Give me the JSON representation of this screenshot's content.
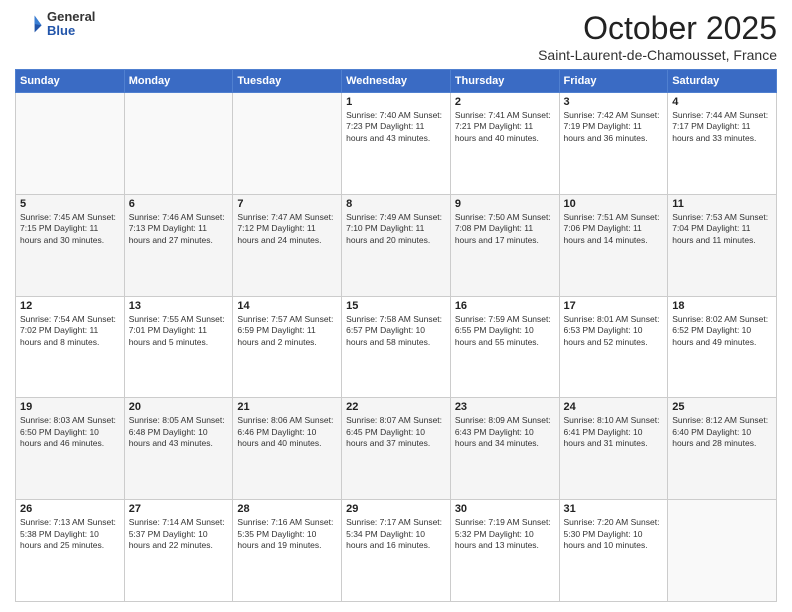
{
  "header": {
    "logo": {
      "general": "General",
      "blue": "Blue"
    },
    "title": "October 2025",
    "subtitle": "Saint-Laurent-de-Chamousset, France"
  },
  "weekdays": [
    "Sunday",
    "Monday",
    "Tuesday",
    "Wednesday",
    "Thursday",
    "Friday",
    "Saturday"
  ],
  "weeks": [
    [
      {
        "day": "",
        "info": ""
      },
      {
        "day": "",
        "info": ""
      },
      {
        "day": "",
        "info": ""
      },
      {
        "day": "1",
        "info": "Sunrise: 7:40 AM\nSunset: 7:23 PM\nDaylight: 11 hours\nand 43 minutes."
      },
      {
        "day": "2",
        "info": "Sunrise: 7:41 AM\nSunset: 7:21 PM\nDaylight: 11 hours\nand 40 minutes."
      },
      {
        "day": "3",
        "info": "Sunrise: 7:42 AM\nSunset: 7:19 PM\nDaylight: 11 hours\nand 36 minutes."
      },
      {
        "day": "4",
        "info": "Sunrise: 7:44 AM\nSunset: 7:17 PM\nDaylight: 11 hours\nand 33 minutes."
      }
    ],
    [
      {
        "day": "5",
        "info": "Sunrise: 7:45 AM\nSunset: 7:15 PM\nDaylight: 11 hours\nand 30 minutes."
      },
      {
        "day": "6",
        "info": "Sunrise: 7:46 AM\nSunset: 7:13 PM\nDaylight: 11 hours\nand 27 minutes."
      },
      {
        "day": "7",
        "info": "Sunrise: 7:47 AM\nSunset: 7:12 PM\nDaylight: 11 hours\nand 24 minutes."
      },
      {
        "day": "8",
        "info": "Sunrise: 7:49 AM\nSunset: 7:10 PM\nDaylight: 11 hours\nand 20 minutes."
      },
      {
        "day": "9",
        "info": "Sunrise: 7:50 AM\nSunset: 7:08 PM\nDaylight: 11 hours\nand 17 minutes."
      },
      {
        "day": "10",
        "info": "Sunrise: 7:51 AM\nSunset: 7:06 PM\nDaylight: 11 hours\nand 14 minutes."
      },
      {
        "day": "11",
        "info": "Sunrise: 7:53 AM\nSunset: 7:04 PM\nDaylight: 11 hours\nand 11 minutes."
      }
    ],
    [
      {
        "day": "12",
        "info": "Sunrise: 7:54 AM\nSunset: 7:02 PM\nDaylight: 11 hours\nand 8 minutes."
      },
      {
        "day": "13",
        "info": "Sunrise: 7:55 AM\nSunset: 7:01 PM\nDaylight: 11 hours\nand 5 minutes."
      },
      {
        "day": "14",
        "info": "Sunrise: 7:57 AM\nSunset: 6:59 PM\nDaylight: 11 hours\nand 2 minutes."
      },
      {
        "day": "15",
        "info": "Sunrise: 7:58 AM\nSunset: 6:57 PM\nDaylight: 10 hours\nand 58 minutes."
      },
      {
        "day": "16",
        "info": "Sunrise: 7:59 AM\nSunset: 6:55 PM\nDaylight: 10 hours\nand 55 minutes."
      },
      {
        "day": "17",
        "info": "Sunrise: 8:01 AM\nSunset: 6:53 PM\nDaylight: 10 hours\nand 52 minutes."
      },
      {
        "day": "18",
        "info": "Sunrise: 8:02 AM\nSunset: 6:52 PM\nDaylight: 10 hours\nand 49 minutes."
      }
    ],
    [
      {
        "day": "19",
        "info": "Sunrise: 8:03 AM\nSunset: 6:50 PM\nDaylight: 10 hours\nand 46 minutes."
      },
      {
        "day": "20",
        "info": "Sunrise: 8:05 AM\nSunset: 6:48 PM\nDaylight: 10 hours\nand 43 minutes."
      },
      {
        "day": "21",
        "info": "Sunrise: 8:06 AM\nSunset: 6:46 PM\nDaylight: 10 hours\nand 40 minutes."
      },
      {
        "day": "22",
        "info": "Sunrise: 8:07 AM\nSunset: 6:45 PM\nDaylight: 10 hours\nand 37 minutes."
      },
      {
        "day": "23",
        "info": "Sunrise: 8:09 AM\nSunset: 6:43 PM\nDaylight: 10 hours\nand 34 minutes."
      },
      {
        "day": "24",
        "info": "Sunrise: 8:10 AM\nSunset: 6:41 PM\nDaylight: 10 hours\nand 31 minutes."
      },
      {
        "day": "25",
        "info": "Sunrise: 8:12 AM\nSunset: 6:40 PM\nDaylight: 10 hours\nand 28 minutes."
      }
    ],
    [
      {
        "day": "26",
        "info": "Sunrise: 7:13 AM\nSunset: 5:38 PM\nDaylight: 10 hours\nand 25 minutes."
      },
      {
        "day": "27",
        "info": "Sunrise: 7:14 AM\nSunset: 5:37 PM\nDaylight: 10 hours\nand 22 minutes."
      },
      {
        "day": "28",
        "info": "Sunrise: 7:16 AM\nSunset: 5:35 PM\nDaylight: 10 hours\nand 19 minutes."
      },
      {
        "day": "29",
        "info": "Sunrise: 7:17 AM\nSunset: 5:34 PM\nDaylight: 10 hours\nand 16 minutes."
      },
      {
        "day": "30",
        "info": "Sunrise: 7:19 AM\nSunset: 5:32 PM\nDaylight: 10 hours\nand 13 minutes."
      },
      {
        "day": "31",
        "info": "Sunrise: 7:20 AM\nSunset: 5:30 PM\nDaylight: 10 hours\nand 10 minutes."
      },
      {
        "day": "",
        "info": ""
      }
    ]
  ]
}
